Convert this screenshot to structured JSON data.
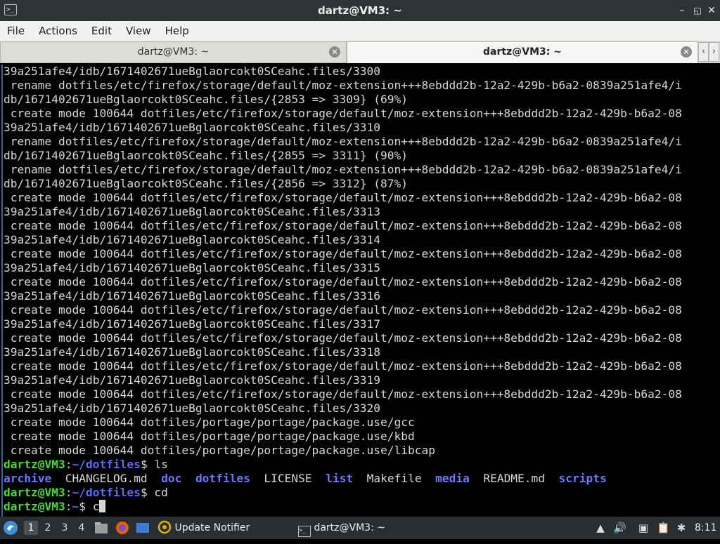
{
  "window": {
    "title": "dartz@VM3: ~",
    "icon": "terminal-icon"
  },
  "menubar": {
    "items": [
      "File",
      "Actions",
      "Edit",
      "View",
      "Help"
    ]
  },
  "tabs": [
    {
      "label": "dartz@VM3: ~",
      "active": false
    },
    {
      "label": "dartz@VM3: ~",
      "active": true
    }
  ],
  "terminal": {
    "lines": [
      "39a251afe4/idb/1671402671ueBglaorcokt0SCeahc.files/3300",
      " rename dotfiles/etc/firefox/storage/default/moz-extension+++8ebddd2b-12a2-429b-b6a2-0839a251afe4/i",
      "db/1671402671ueBglaorcokt0SCeahc.files/{2853 => 3309} (69%)",
      " create mode 100644 dotfiles/etc/firefox/storage/default/moz-extension+++8ebddd2b-12a2-429b-b6a2-08",
      "39a251afe4/idb/1671402671ueBglaorcokt0SCeahc.files/3310",
      " rename dotfiles/etc/firefox/storage/default/moz-extension+++8ebddd2b-12a2-429b-b6a2-0839a251afe4/i",
      "db/1671402671ueBglaorcokt0SCeahc.files/{2855 => 3311} (90%)",
      " rename dotfiles/etc/firefox/storage/default/moz-extension+++8ebddd2b-12a2-429b-b6a2-0839a251afe4/i",
      "db/1671402671ueBglaorcokt0SCeahc.files/{2856 => 3312} (87%)",
      " create mode 100644 dotfiles/etc/firefox/storage/default/moz-extension+++8ebddd2b-12a2-429b-b6a2-08",
      "39a251afe4/idb/1671402671ueBglaorcokt0SCeahc.files/3313",
      " create mode 100644 dotfiles/etc/firefox/storage/default/moz-extension+++8ebddd2b-12a2-429b-b6a2-08",
      "39a251afe4/idb/1671402671ueBglaorcokt0SCeahc.files/3314",
      " create mode 100644 dotfiles/etc/firefox/storage/default/moz-extension+++8ebddd2b-12a2-429b-b6a2-08",
      "39a251afe4/idb/1671402671ueBglaorcokt0SCeahc.files/3315",
      " create mode 100644 dotfiles/etc/firefox/storage/default/moz-extension+++8ebddd2b-12a2-429b-b6a2-08",
      "39a251afe4/idb/1671402671ueBglaorcokt0SCeahc.files/3316",
      " create mode 100644 dotfiles/etc/firefox/storage/default/moz-extension+++8ebddd2b-12a2-429b-b6a2-08",
      "39a251afe4/idb/1671402671ueBglaorcokt0SCeahc.files/3317",
      " create mode 100644 dotfiles/etc/firefox/storage/default/moz-extension+++8ebddd2b-12a2-429b-b6a2-08",
      "39a251afe4/idb/1671402671ueBglaorcokt0SCeahc.files/3318",
      " create mode 100644 dotfiles/etc/firefox/storage/default/moz-extension+++8ebddd2b-12a2-429b-b6a2-08",
      "39a251afe4/idb/1671402671ueBglaorcokt0SCeahc.files/3319",
      " create mode 100644 dotfiles/etc/firefox/storage/default/moz-extension+++8ebddd2b-12a2-429b-b6a2-08",
      "39a251afe4/idb/1671402671ueBglaorcokt0SCeahc.files/3320",
      " create mode 100644 dotfiles/portage/portage/package.use/gcc",
      " create mode 100644 dotfiles/portage/portage/package.use/kbd",
      " create mode 100644 dotfiles/portage/portage/package.use/libcap"
    ],
    "prompt1": {
      "user": "dartz@VM3",
      "sep": ":",
      "path": "~/dotfiles",
      "sym": "$",
      "cmd": " ls"
    },
    "ls": {
      "archive": "archive",
      "changelog": "CHANGELOG.md",
      "doc": "doc",
      "dotfiles": "dotfiles",
      "license": "LICENSE",
      "list": "list",
      "makefile": "Makefile",
      "media": "media",
      "readme": "README.md",
      "scripts": "scripts"
    },
    "prompt2": {
      "user": "dartz@VM3",
      "sep": ":",
      "path": "~/dotfiles",
      "sym": "$",
      "cmd": " cd"
    },
    "prompt3": {
      "user": "dartz@VM3",
      "sep": ":",
      "path": "~",
      "sym": "$",
      "cmd": " c"
    }
  },
  "taskbar": {
    "workspaces": [
      "1",
      "2",
      "3",
      "4"
    ],
    "active_workspace": "1",
    "tasks": [
      {
        "label": "Update Notifier",
        "icon": "update-notifier-icon"
      },
      {
        "label": "dartz@VM3: ~",
        "icon": "terminal-icon"
      }
    ],
    "clock": "8:11"
  },
  "colors": {
    "prompt_user": "#4cd93a",
    "prompt_path": "#5c6cf0",
    "directory": "#6e79ff",
    "terminal_bg": "#000000",
    "terminal_fg": "#d7d7d7"
  }
}
